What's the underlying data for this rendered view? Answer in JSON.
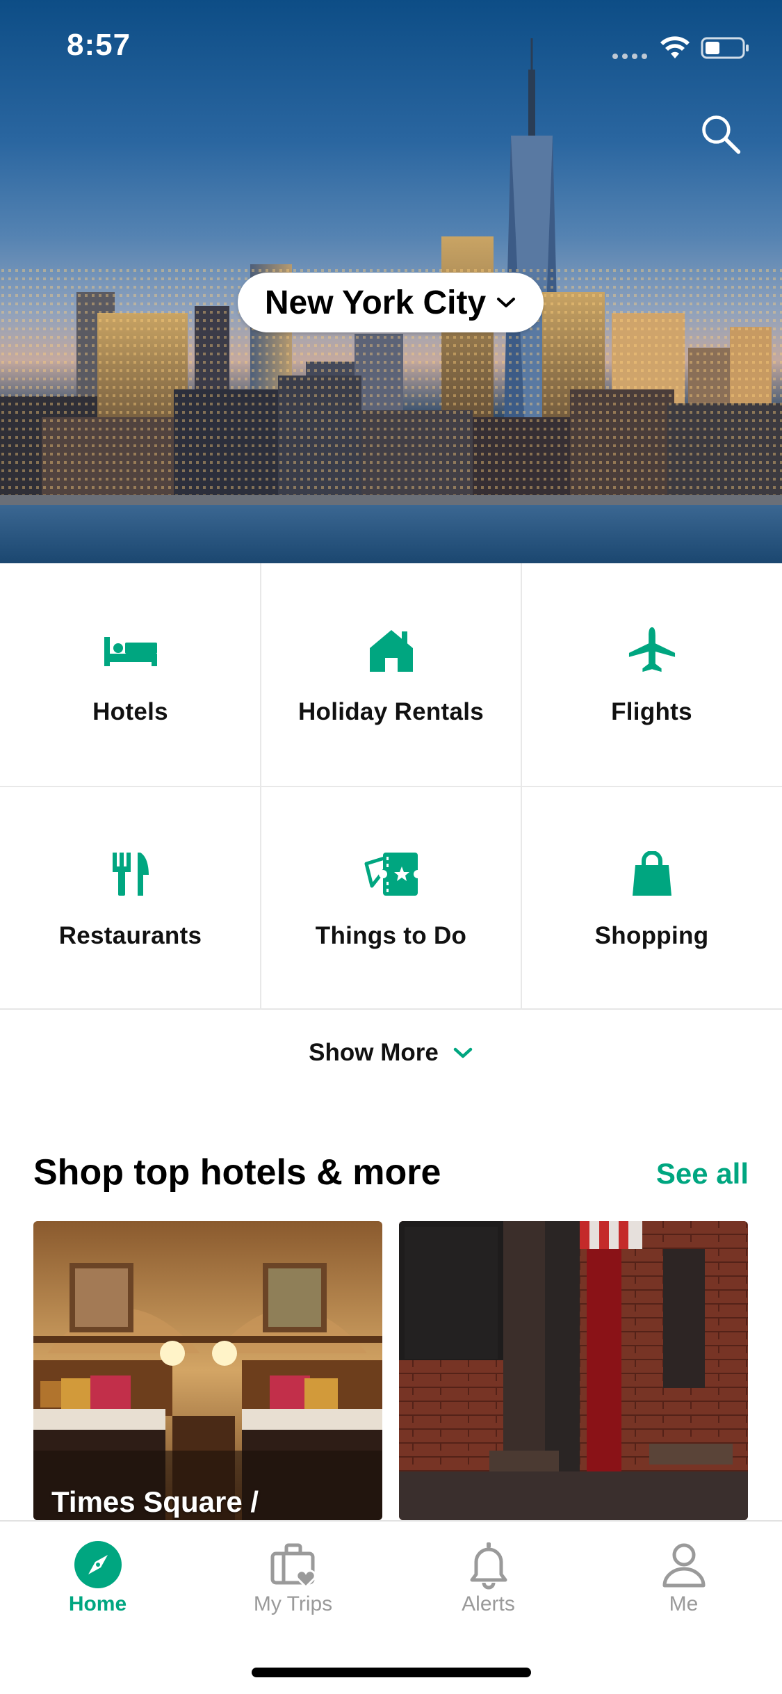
{
  "status_bar": {
    "time": "8:57"
  },
  "hero": {
    "city": "New York City",
    "icons": {
      "search": "search-icon",
      "city_dropdown": "chevron-down-icon"
    }
  },
  "categories": [
    {
      "label": "Hotels",
      "icon": "bed-icon"
    },
    {
      "label": "Holiday Rentals",
      "icon": "house-icon"
    },
    {
      "label": "Flights",
      "icon": "plane-icon"
    },
    {
      "label": "Restaurants",
      "icon": "fork-knife-icon"
    },
    {
      "label": "Things to Do",
      "icon": "ticket-icon"
    },
    {
      "label": "Shopping",
      "icon": "shopping-bag-icon"
    }
  ],
  "show_more": {
    "label": "Show More"
  },
  "section": {
    "title": "Shop top hotels & more",
    "see_all": "See all",
    "cards": [
      {
        "title": "Times Square /"
      },
      {
        "title": ""
      }
    ]
  },
  "tabbar": {
    "tabs": [
      {
        "label": "Home",
        "icon": "compass-icon",
        "active": true
      },
      {
        "label": "My Trips",
        "icon": "suitcase-heart-icon",
        "active": false
      },
      {
        "label": "Alerts",
        "icon": "bell-icon",
        "active": false
      },
      {
        "label": "Me",
        "icon": "person-icon",
        "active": false
      }
    ]
  },
  "colors": {
    "accent": "#00a680",
    "inactive": "#9a9a9a",
    "text": "#111111"
  }
}
